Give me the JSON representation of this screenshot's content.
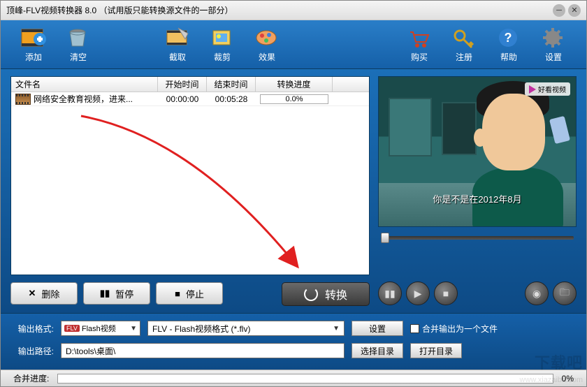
{
  "title": "顶峰-FLV视频转换器 8.0 （试用版只能转换源文件的一部分）",
  "toolbar": {
    "add": "添加",
    "clear": "清空",
    "snapshot": "截取",
    "crop": "裁剪",
    "effect": "效果",
    "buy": "购买",
    "register": "注册",
    "help": "帮助",
    "settings": "设置"
  },
  "columns": {
    "name": "文件名",
    "start": "开始时间",
    "end": "结束时间",
    "progress": "转换进度"
  },
  "rows": [
    {
      "name": "网络安全教育视频，进来...",
      "start": "00:00:00",
      "end": "00:05:28",
      "progress": "0.0%"
    }
  ],
  "actions": {
    "delete": "删除",
    "pause": "暂停",
    "stop": "停止",
    "convert": "转换"
  },
  "preview": {
    "watermark": "好看视频",
    "subtitle": "你是不是在2012年8月"
  },
  "output": {
    "format_label": "输出格式:",
    "format_short": "Flash视频",
    "format_long": "FLV - Flash视频格式 (*.flv)",
    "settings_btn": "设置",
    "merge_label": "合并输出为一个文件",
    "path_label": "输出路径:",
    "path_value": "D:\\tools\\桌面\\",
    "choose_dir": "选择目录",
    "open_dir": "打开目录"
  },
  "status": {
    "merge_progress_label": "合并进度:",
    "percent": "0%"
  },
  "watermark": {
    "brand": "下载吧",
    "url": "www.xiazaiba.com"
  }
}
